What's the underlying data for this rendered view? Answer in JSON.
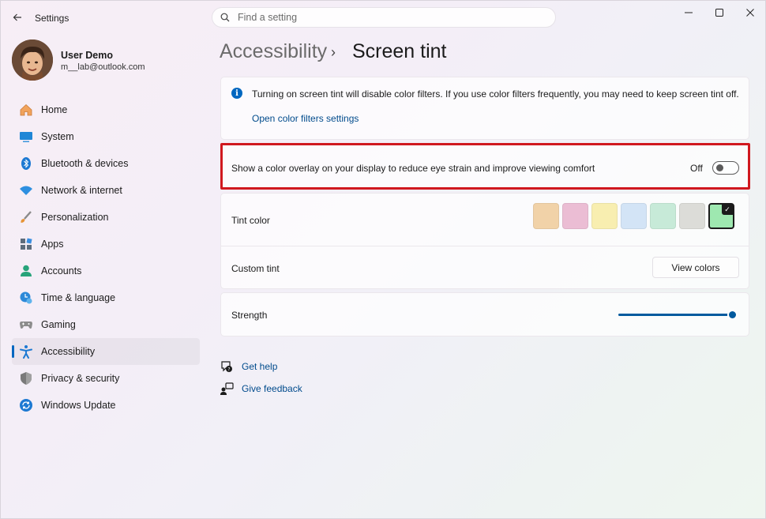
{
  "app": {
    "title": "Settings"
  },
  "search": {
    "placeholder": "Find a setting"
  },
  "user": {
    "name": "User Demo",
    "email": "m__lab@outlook.com"
  },
  "sidebar": {
    "items": [
      {
        "label": "Home",
        "icon": "home-icon"
      },
      {
        "label": "System",
        "icon": "system-icon"
      },
      {
        "label": "Bluetooth & devices",
        "icon": "bluetooth-icon"
      },
      {
        "label": "Network & internet",
        "icon": "network-icon"
      },
      {
        "label": "Personalization",
        "icon": "brush-icon"
      },
      {
        "label": "Apps",
        "icon": "apps-icon"
      },
      {
        "label": "Accounts",
        "icon": "accounts-icon"
      },
      {
        "label": "Time & language",
        "icon": "time-language-icon"
      },
      {
        "label": "Gaming",
        "icon": "gaming-icon"
      },
      {
        "label": "Accessibility",
        "icon": "accessibility-icon"
      },
      {
        "label": "Privacy & security",
        "icon": "shield-icon"
      },
      {
        "label": "Windows Update",
        "icon": "update-icon"
      }
    ],
    "active": "Accessibility"
  },
  "breadcrumb": {
    "parent": "Accessibility",
    "separator": "›",
    "current": "Screen tint"
  },
  "info": {
    "text": "Turning on screen tint will disable color filters. If you use color filters frequently, you may need to keep screen tint off.",
    "link": "Open color filters settings"
  },
  "overlay": {
    "description": "Show a color overlay on your display to reduce eye strain and improve viewing comfort",
    "toggle_state": "Off"
  },
  "tint": {
    "label": "Tint color",
    "swatches": [
      "#f1d2a8",
      "#ebbdd4",
      "#f8eeb0",
      "#d3e4f6",
      "#c7ead8",
      "#dcdcd8",
      "#9ee8b0"
    ],
    "selected_index": 6,
    "custom_label": "Custom tint",
    "view_colors": "View colors"
  },
  "strength": {
    "label": "Strength",
    "value_fraction": 1.0
  },
  "help": {
    "get_help": "Get help",
    "give_feedback": "Give feedback"
  },
  "colors": {
    "accent": "#0067c0",
    "highlight_border": "#d0181f"
  }
}
